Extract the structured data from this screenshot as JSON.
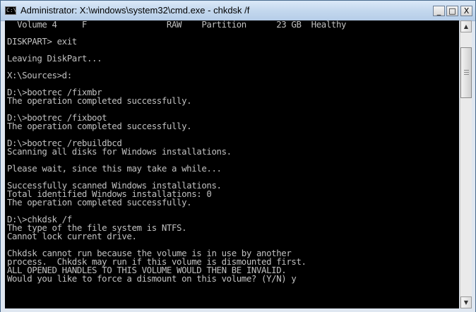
{
  "window": {
    "title": "Administrator: X:\\windows\\system32\\cmd.exe - chkdsk  /f",
    "app_icon_glyph": "C:\\",
    "icon": "cmd-icon",
    "buttons": {
      "minimize": "_",
      "maximize": "□",
      "close": "X"
    }
  },
  "console": {
    "lines": [
      "  Volume 4     F                RAW    Partition      23 GB  Healthy",
      "",
      "DISKPART> exit",
      "",
      "Leaving DiskPart...",
      "",
      "X:\\Sources>d:",
      "",
      "D:\\>bootrec /fixmbr",
      "The operation completed successfully.",
      "",
      "D:\\>bootrec /fixboot",
      "The operation completed successfully.",
      "",
      "D:\\>bootrec /rebuildbcd",
      "Scanning all disks for Windows installations.",
      "",
      "Please wait, since this may take a while...",
      "",
      "Successfully scanned Windows installations.",
      "Total identified Windows installations: 0",
      "The operation completed successfully.",
      "",
      "D:\\>chkdsk /f",
      "The type of the file system is NTFS.",
      "Cannot lock current drive.",
      "",
      "Chkdsk cannot run because the volume is in use by another",
      "process.  Chkdsk may run if this volume is dismounted first.",
      "ALL OPENED HANDLES TO THIS VOLUME WOULD THEN BE INVALID.",
      "Would you like to force a dismount on this volume? (Y/N) y"
    ]
  },
  "scrollbar": {
    "up_glyph": "▲",
    "down_glyph": "▼"
  },
  "colors": {
    "console_bg": "#000000",
    "console_fg": "#c0c0c0",
    "titlebar": "#c4d8ee"
  }
}
